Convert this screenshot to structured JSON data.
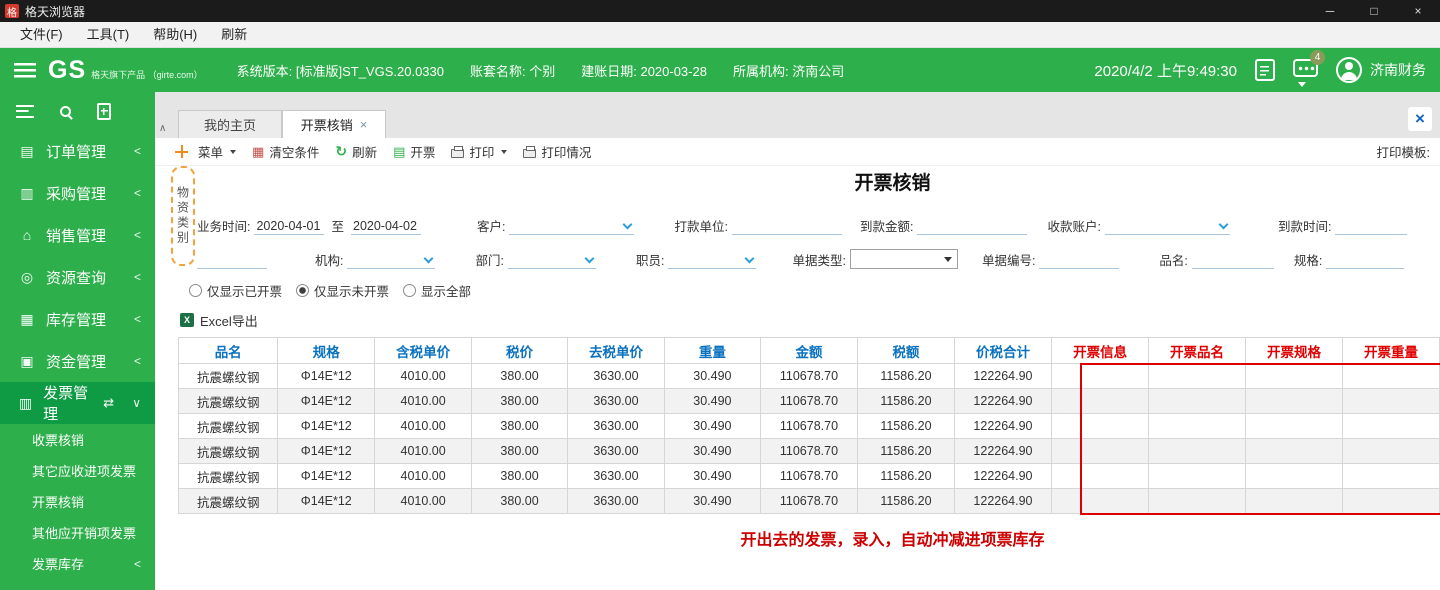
{
  "colors": {
    "accent_green": "#2db04b",
    "active_green": "#0e9b43",
    "header_blue": "#0b72c0",
    "alert_red": "#e10000",
    "highlight_orange": "#f2a33c"
  },
  "titlebar": {
    "app_title": "格天浏览器",
    "app_icon": "格"
  },
  "icons": {
    "minimize": "─",
    "maximize": "□",
    "close": "×",
    "tab_close": "×",
    "close_all": "×",
    "scroll_up": "∧",
    "excel_glyph": "X"
  },
  "menubar": {
    "items": [
      "文件(F)",
      "工具(T)",
      "帮助(H)",
      "刷新"
    ]
  },
  "header": {
    "logo": "GS",
    "logo_tagline": "格天旗下产品 （girte.com）",
    "system_version": "系统版本: [标准版]ST_VGS.20.0330",
    "account_name": "账套名称: 个别",
    "book_date": "建账日期: 2020-03-28",
    "org": "所属机构: 济南公司",
    "datetime": "2020/4/2 上午9:49:30",
    "message_badge": "4",
    "user": "济南财务"
  },
  "sidebar": {
    "items": [
      {
        "id": "orders",
        "label": "订单管理",
        "glyph": "▤",
        "icon": "order-icon",
        "arrow": "<"
      },
      {
        "id": "purchase",
        "label": "采购管理",
        "glyph": "▥",
        "icon": "purchase-icon",
        "arrow": "<"
      },
      {
        "id": "sales",
        "label": "销售管理",
        "glyph": "⌂",
        "icon": "sales-icon",
        "arrow": "<"
      },
      {
        "id": "resources",
        "label": "资源查询",
        "glyph": "◎",
        "icon": "resource-search-icon",
        "arrow": "<"
      },
      {
        "id": "inventory",
        "label": "库存管理",
        "glyph": "▦",
        "icon": "inventory-icon",
        "arrow": "<"
      },
      {
        "id": "funds",
        "label": "资金管理",
        "glyph": "▣",
        "icon": "funds-icon",
        "arrow": "<"
      },
      {
        "id": "invoices",
        "label": "发票管理",
        "glyph": "▥",
        "icon": "invoice-icon",
        "extra": "⇄",
        "arrow": "∨",
        "active": true
      }
    ],
    "subitems": [
      {
        "id": "receipt-writeoff",
        "label": "收票核销"
      },
      {
        "id": "other-input-invoice",
        "label": "其它应收进项发票"
      },
      {
        "id": "invoice-writeoff",
        "label": "开票核销",
        "active": true
      },
      {
        "id": "other-output-invoice",
        "label": "其他应开销项发票"
      },
      {
        "id": "invoice-stock",
        "label": "发票库存",
        "arrow": "<"
      }
    ]
  },
  "tabs": [
    {
      "label": "我的主页"
    },
    {
      "label": "开票核销",
      "active": true
    }
  ],
  "toolbar": {
    "menu": "菜单",
    "clear": "清空条件",
    "refresh": "刷新",
    "invoice": "开票",
    "print": "打印",
    "print_status": "打印情况",
    "print_template": "打印模板:",
    "clear_icon_glyph": "▦",
    "refresh_icon_glyph": "↻",
    "invoice_icon_glyph": "▤"
  },
  "page": {
    "title": "开票核销",
    "annotation": "开出去的发票，录入，自动冲减进项票库存"
  },
  "filters": {
    "material_category": "物资类别",
    "business_time_label": "业务时间:",
    "business_time_from": "2020-04-01",
    "to_label": "至",
    "business_time_to": "2020-04-02",
    "customer_label": "客户:",
    "payer_label": "打款单位:",
    "amount_label": "到款金额:",
    "account_label": "收款账户:",
    "arrival_time_label": "到款时间:",
    "org_label": "机构:",
    "dept_label": "部门:",
    "staff_label": "职员:",
    "doc_type_label": "单据类型:",
    "doc_no_label": "单据编号:",
    "product_label": "品名:",
    "spec_label": "规格:",
    "radio_options": [
      "仅显示已开票",
      "仅显示未开票",
      "显示全部"
    ],
    "radio_ids": [
      "show-invoiced",
      "show-uninvoiced",
      "show-all"
    ],
    "radio_selected": 1
  },
  "export": {
    "label": "Excel导出"
  },
  "table": {
    "headers": [
      {
        "label": "品名",
        "color": "blue"
      },
      {
        "label": "规格",
        "color": "blue"
      },
      {
        "label": "含税单价",
        "color": "blue"
      },
      {
        "label": "税价",
        "color": "blue"
      },
      {
        "label": "去税单价",
        "color": "blue"
      },
      {
        "label": "重量",
        "color": "blue"
      },
      {
        "label": "金额",
        "color": "blue"
      },
      {
        "label": "税额",
        "color": "blue"
      },
      {
        "label": "价税合计",
        "color": "blue"
      },
      {
        "label": "开票信息",
        "color": "red"
      },
      {
        "label": "开票品名",
        "color": "red"
      },
      {
        "label": "开票规格",
        "color": "red"
      },
      {
        "label": "开票重量",
        "color": "red"
      }
    ],
    "rows": [
      [
        "抗震螺纹钢",
        "Φ14E*12",
        "4010.00",
        "380.00",
        "3630.00",
        "30.490",
        "110678.70",
        "11586.20",
        "122264.90",
        "",
        "",
        "",
        ""
      ],
      [
        "抗震螺纹钢",
        "Φ14E*12",
        "4010.00",
        "380.00",
        "3630.00",
        "30.490",
        "110678.70",
        "11586.20",
        "122264.90",
        "",
        "",
        "",
        ""
      ],
      [
        "抗震螺纹钢",
        "Φ14E*12",
        "4010.00",
        "380.00",
        "3630.00",
        "30.490",
        "110678.70",
        "11586.20",
        "122264.90",
        "",
        "",
        "",
        ""
      ],
      [
        "抗震螺纹钢",
        "Φ14E*12",
        "4010.00",
        "380.00",
        "3630.00",
        "30.490",
        "110678.70",
        "11586.20",
        "122264.90",
        "",
        "",
        "",
        ""
      ],
      [
        "抗震螺纹钢",
        "Φ14E*12",
        "4010.00",
        "380.00",
        "3630.00",
        "30.490",
        "110678.70",
        "11586.20",
        "122264.90",
        "",
        "",
        "",
        ""
      ],
      [
        "抗震螺纹钢",
        "Φ14E*12",
        "4010.00",
        "380.00",
        "3630.00",
        "30.490",
        "110678.70",
        "11586.20",
        "122264.90",
        "",
        "",
        "",
        ""
      ]
    ]
  }
}
